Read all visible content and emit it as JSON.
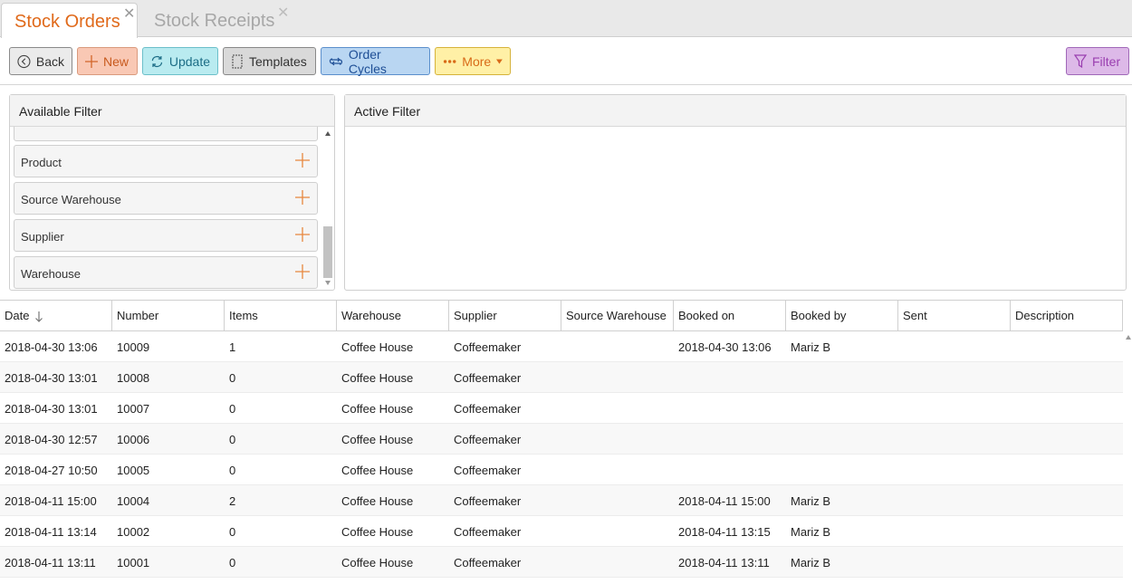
{
  "tabs": [
    {
      "label": "Stock Orders",
      "active": true
    },
    {
      "label": "Stock Receipts",
      "active": false
    }
  ],
  "toolbar": {
    "back": "Back",
    "new": "New",
    "update": "Update",
    "templates": "Templates",
    "order_cycles": "Order Cycles",
    "more": "More",
    "filter": "Filter"
  },
  "available_filter": {
    "title": "Available Filter",
    "items": [
      "Product",
      "Source Warehouse",
      "Supplier",
      "Warehouse"
    ]
  },
  "active_filter": {
    "title": "Active Filter"
  },
  "table": {
    "columns": [
      "Date",
      "Number",
      "Items",
      "Warehouse",
      "Supplier",
      "Source Warehouse",
      "Booked on",
      "Booked by",
      "Sent",
      "Description"
    ],
    "sort_column": "Date",
    "rows": [
      [
        "2018-04-30 13:06",
        "10009",
        "1",
        "Coffee House",
        "Coffeemaker",
        "",
        "2018-04-30 13:06",
        "Mariz B",
        "",
        ""
      ],
      [
        "2018-04-30 13:01",
        "10008",
        "0",
        "Coffee House",
        "Coffeemaker",
        "",
        "",
        "",
        "",
        ""
      ],
      [
        "2018-04-30 13:01",
        "10007",
        "0",
        "Coffee House",
        "Coffeemaker",
        "",
        "",
        "",
        "",
        ""
      ],
      [
        "2018-04-30 12:57",
        "10006",
        "0",
        "Coffee House",
        "Coffeemaker",
        "",
        "",
        "",
        "",
        ""
      ],
      [
        "2018-04-27 10:50",
        "10005",
        "0",
        "Coffee House",
        "Coffeemaker",
        "",
        "",
        "",
        "",
        ""
      ],
      [
        "2018-04-11 15:00",
        "10004",
        "2",
        "Coffee House",
        "Coffeemaker",
        "",
        "2018-04-11 15:00",
        "Mariz B",
        "",
        ""
      ],
      [
        "2018-04-11 13:14",
        "10002",
        "0",
        "Coffee House",
        "Coffeemaker",
        "",
        "2018-04-11 13:15",
        "Mariz B",
        "",
        ""
      ],
      [
        "2018-04-11 13:11",
        "10001",
        "0",
        "Coffee House",
        "Coffeemaker",
        "",
        "2018-04-11 13:11",
        "Mariz B",
        "",
        ""
      ]
    ]
  },
  "colors": {
    "accent": "#e06a1b",
    "plus": "#e8883e"
  }
}
